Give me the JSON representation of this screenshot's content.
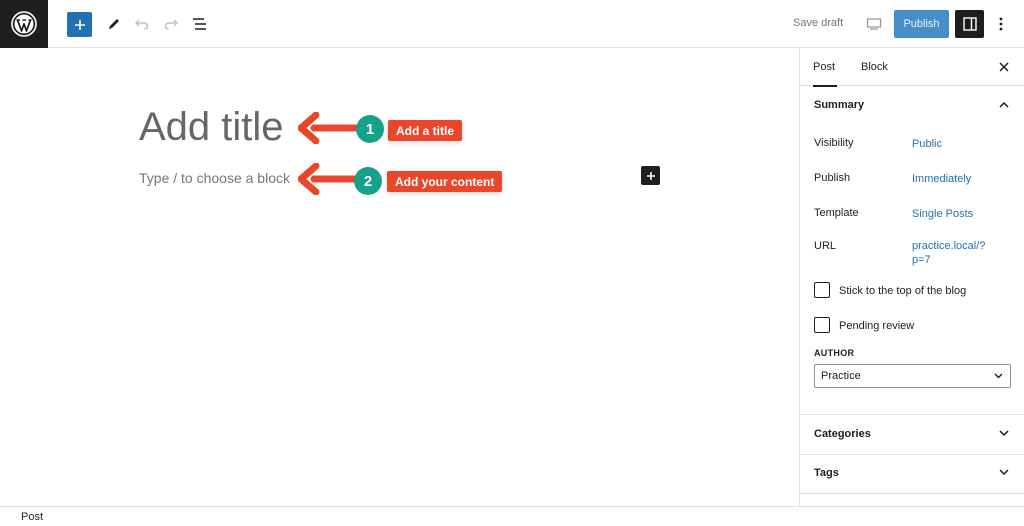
{
  "topbar": {
    "save_draft_label": "Save draft",
    "publish_label": "Publish"
  },
  "editor": {
    "title_placeholder": "Add title",
    "block_placeholder": "Type / to choose a block"
  },
  "annotations": [
    {
      "number": "1",
      "text": "Add a title"
    },
    {
      "number": "2",
      "text": "Add your content"
    }
  ],
  "sidebar": {
    "tabs": [
      {
        "label": "Post",
        "active": true
      },
      {
        "label": "Block",
        "active": false
      }
    ],
    "summary": {
      "heading": "Summary",
      "rows": [
        {
          "label": "Visibility",
          "value": "Public"
        },
        {
          "label": "Publish",
          "value": "Immediately"
        },
        {
          "label": "Template",
          "value": "Single Posts"
        },
        {
          "label": "URL",
          "value": "practice.local/?p=7"
        }
      ],
      "checkboxes": [
        {
          "label": "Stick to the top of the blog",
          "checked": false
        },
        {
          "label": "Pending review",
          "checked": false
        }
      ],
      "author_label": "AUTHOR",
      "author_value": "Practice"
    },
    "panels": [
      {
        "heading": "Categories"
      },
      {
        "heading": "Tags"
      }
    ]
  },
  "footer": {
    "breadcrumb": "Post"
  },
  "colors": {
    "accent": "#2271b1",
    "callout": "#e8472b",
    "step": "#17a08a",
    "dark": "#1e1e1e"
  }
}
